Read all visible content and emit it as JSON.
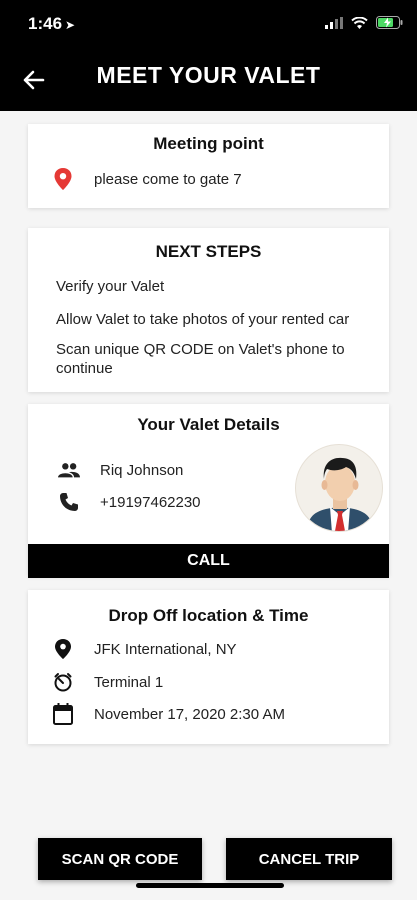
{
  "status_bar": {
    "time": "1:46",
    "location_arrow": "location-arrow-icon",
    "icons": [
      "signal-icon",
      "wifi-icon",
      "battery-charging-icon"
    ]
  },
  "header": {
    "title": "MEET YOUR VALET",
    "back_icon": "back-arrow-icon"
  },
  "meeting_point": {
    "title": "Meeting point",
    "icon": "map-pin-icon",
    "text": "please come to gate 7",
    "pin_color": "#e53935"
  },
  "next_steps": {
    "title": "NEXT STEPS",
    "steps": [
      "Verify your Valet",
      "Allow Valet to take photos of your rented car",
      "Scan unique QR CODE on Valet's phone to continue"
    ]
  },
  "valet_details": {
    "title": "Your Valet Details",
    "name": "Riq Johnson",
    "phone": "+19197462230",
    "name_icon": "people-icon",
    "phone_icon": "phone-icon",
    "avatar_icon": "valet-avatar-icon",
    "call_label": "CALL"
  },
  "drop_off": {
    "title": "Drop Off location & Time",
    "location": "JFK International, NY",
    "terminal": "Terminal 1",
    "datetime": "November 17, 2020 2:30 AM",
    "icons": [
      "location-icon",
      "timer-icon",
      "calendar-icon"
    ]
  },
  "actions": {
    "scan_label": "SCAN QR CODE",
    "cancel_label": "CANCEL TRIP"
  },
  "colors": {
    "header_bg": "#000000",
    "accent_pin": "#e53935",
    "page_bg": "#f5f5f5"
  }
}
